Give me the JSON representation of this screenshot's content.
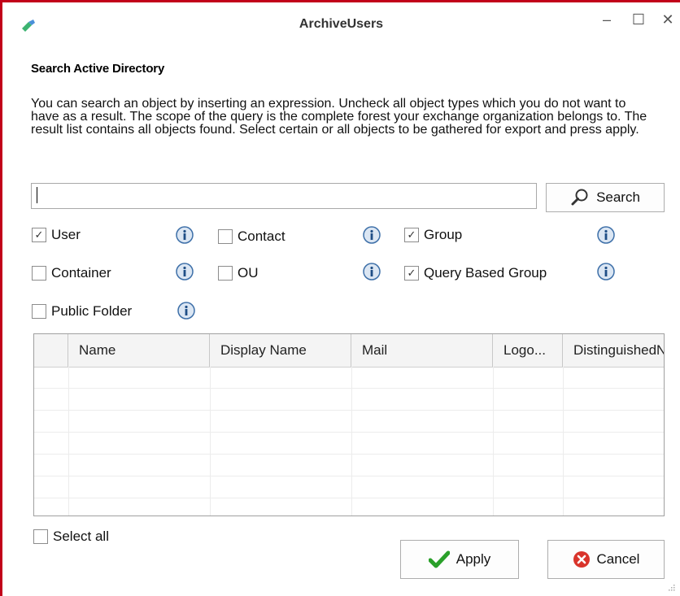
{
  "window": {
    "title": "ArchiveUsers",
    "minimize_glyph": "–",
    "maximize_glyph": "☐",
    "close_glyph": "✕",
    "border_color": "#c2001a"
  },
  "heading": "Search Active Directory",
  "description": "You can search an object by inserting an expression. Uncheck all object types which you do not want to have as a result. The scope of the query is the complete forest your exchange organization belongs to. The result list contains all objects found. Select certain or all objects to be gathered for export and press apply.",
  "search": {
    "value": "",
    "button_label": "Search",
    "icon": "magnifier-icon"
  },
  "object_types": [
    {
      "label": "User",
      "checked": true
    },
    {
      "label": "Contact",
      "checked": false
    },
    {
      "label": "Group",
      "checked": true
    },
    {
      "label": "Container",
      "checked": false
    },
    {
      "label": "OU",
      "checked": false
    },
    {
      "label": "Query Based Group",
      "checked": true
    },
    {
      "label": "Public Folder",
      "checked": false
    }
  ],
  "check_glyph": "✓",
  "info_icon": "info-icon",
  "grid": {
    "columns": [
      "Name",
      "Display Name",
      "Mail",
      "Logo...",
      "DistinguishedN"
    ],
    "rows": []
  },
  "select_all": {
    "label": "Select all",
    "checked": false
  },
  "buttons": {
    "apply": "Apply",
    "cancel": "Cancel"
  },
  "colors": {
    "apply_icon": "#2aa02a",
    "cancel_icon": "#d9342b",
    "info_icon": "#3d6fa8"
  }
}
